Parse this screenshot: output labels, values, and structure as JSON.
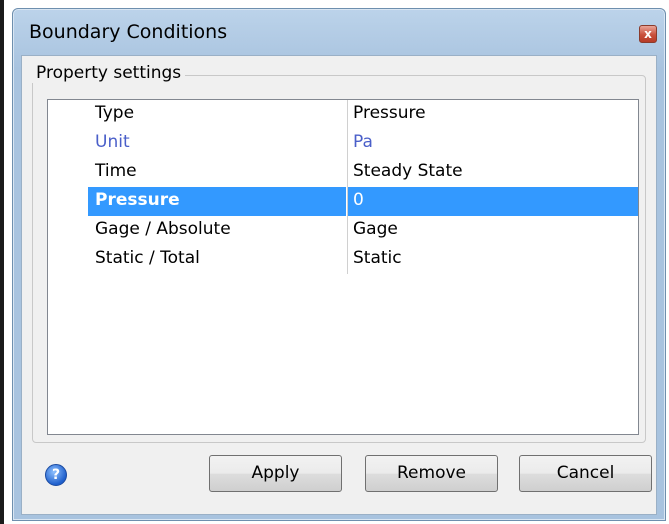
{
  "window": {
    "title": "Boundary Conditions",
    "close_glyph": "x"
  },
  "group": {
    "legend": "Property settings"
  },
  "properties": [
    {
      "name": "Type",
      "value": "Pressure",
      "state": "normal"
    },
    {
      "name": "Unit",
      "value": "Pa",
      "state": "readonly"
    },
    {
      "name": "Time",
      "value": "Steady State",
      "state": "normal"
    },
    {
      "name": "Pressure",
      "value": "0",
      "state": "selected"
    },
    {
      "name": "Gage / Absolute",
      "value": "Gage",
      "state": "normal"
    },
    {
      "name": "Static / Total",
      "value": "Static",
      "state": "normal"
    }
  ],
  "buttons": {
    "apply": "Apply",
    "remove": "Remove",
    "cancel": "Cancel"
  },
  "help": {
    "glyph": "?",
    "icon": "help-icon"
  },
  "colors": {
    "readonly_text": "#4a5fc9",
    "selected_bg": "#3399ff",
    "selected_text": "#ffffff"
  }
}
